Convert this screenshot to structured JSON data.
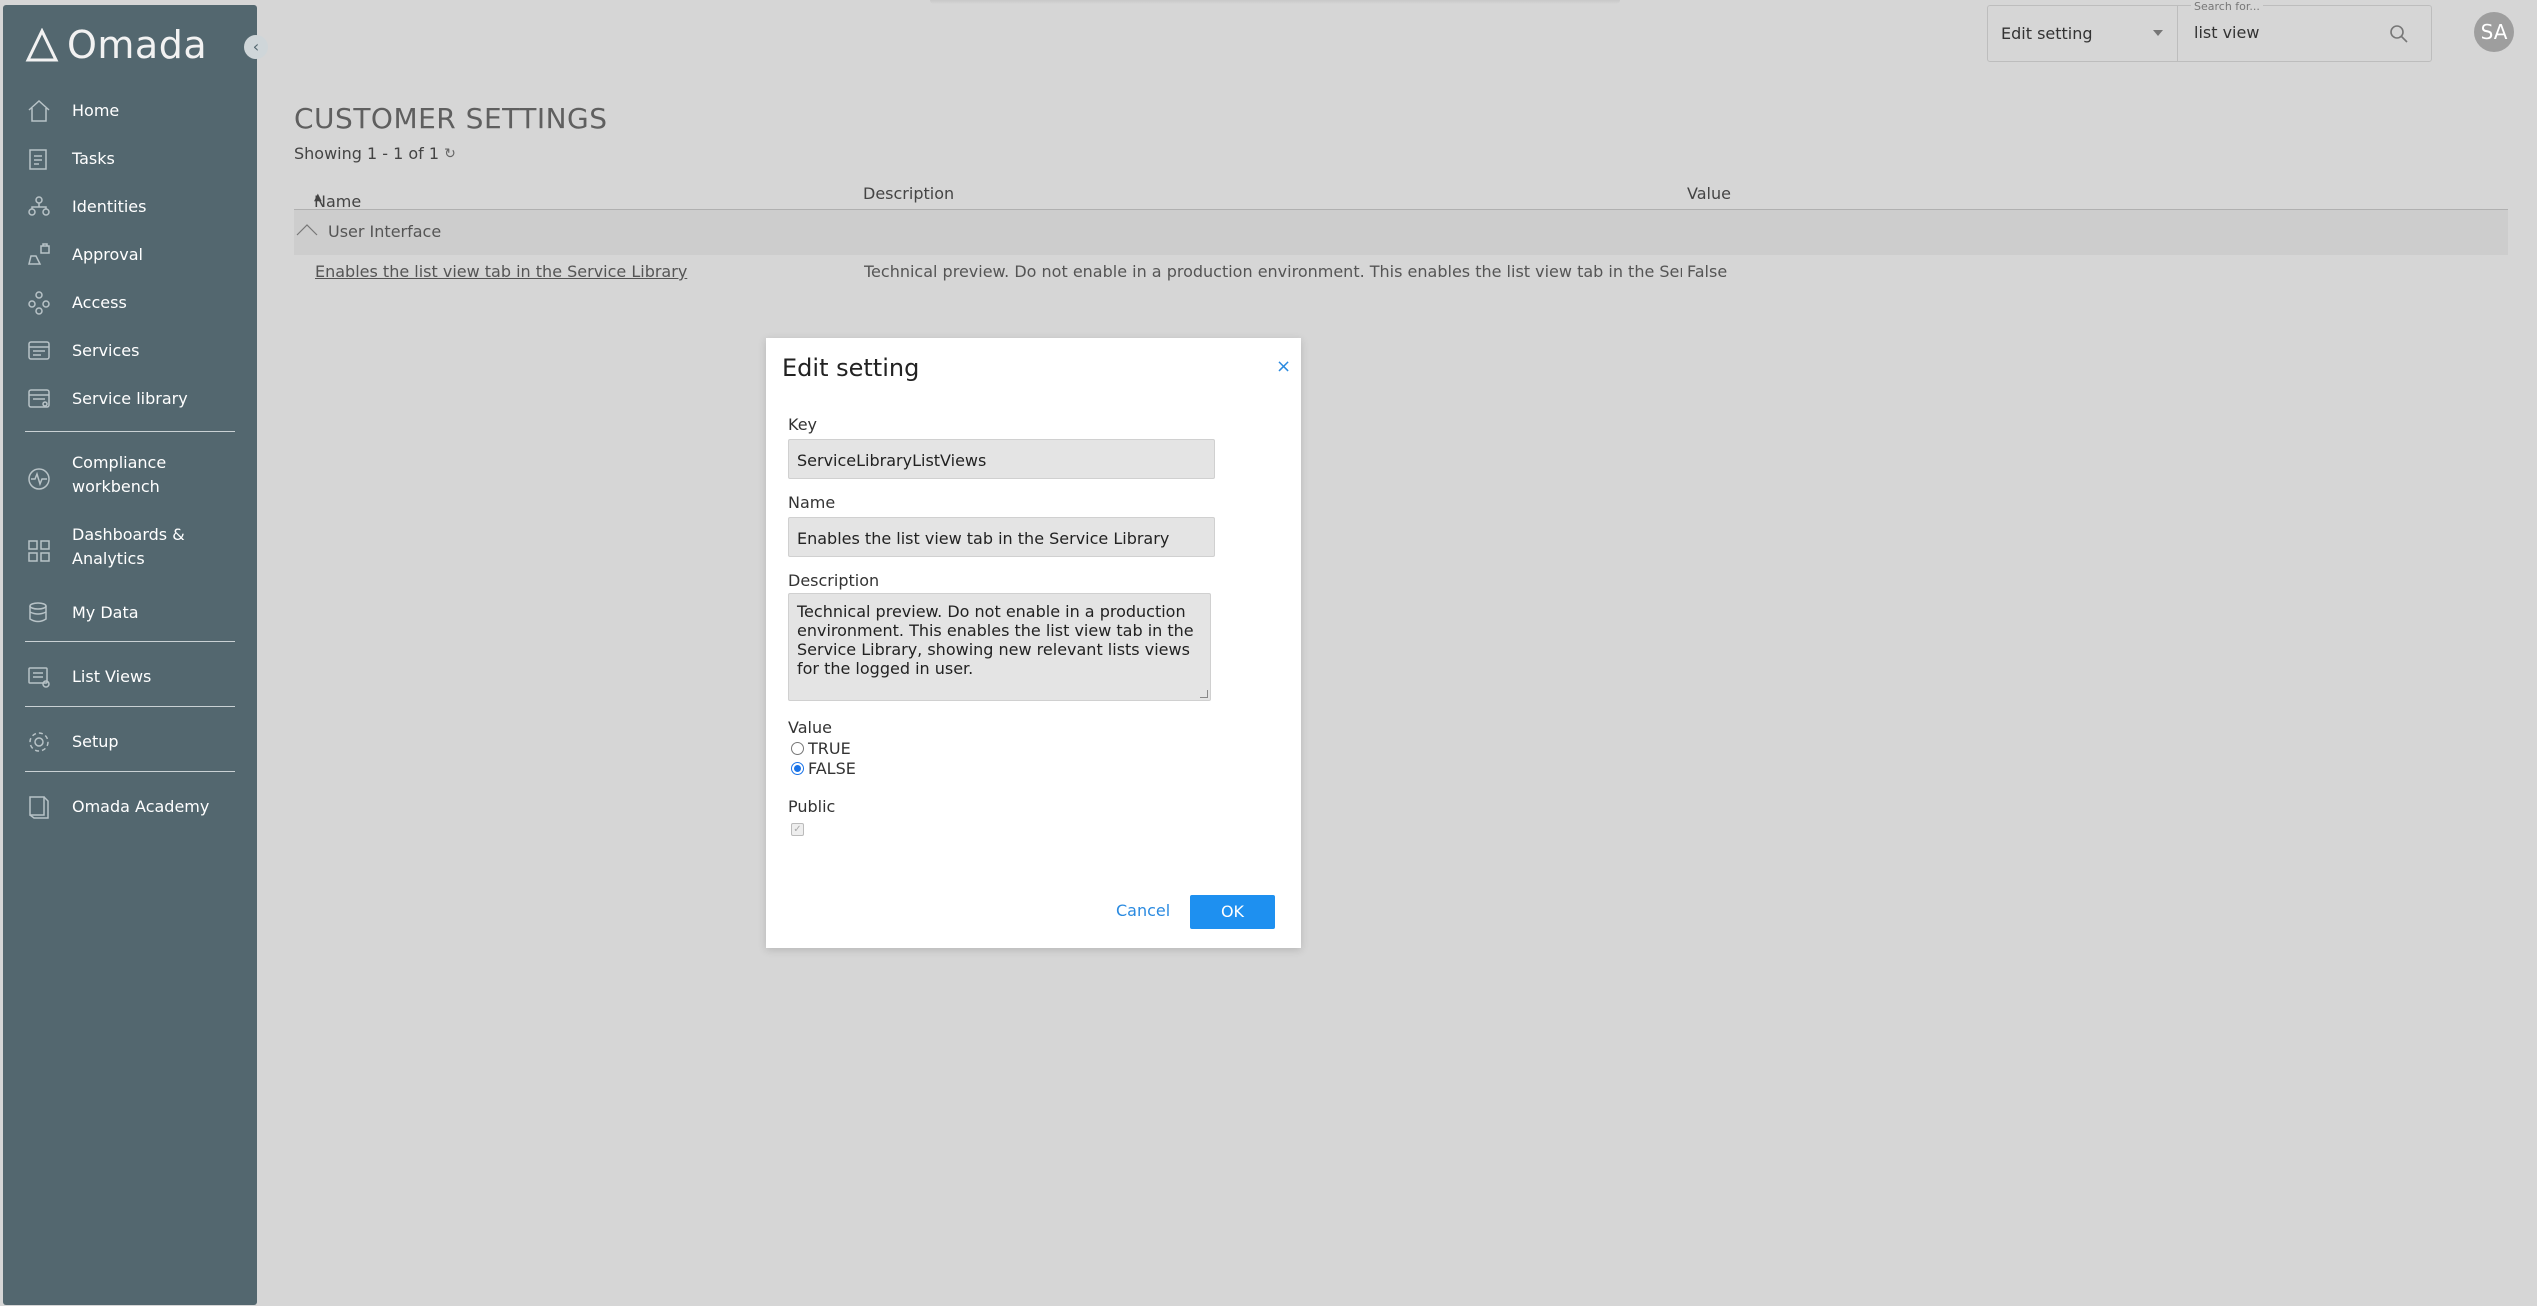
{
  "app": {
    "logo_text": "Omada"
  },
  "sidebar": {
    "items": [
      {
        "label": "Home",
        "icon": "home-icon"
      },
      {
        "label": "Tasks",
        "icon": "tasks-icon"
      },
      {
        "label": "Identities",
        "icon": "identities-icon"
      },
      {
        "label": "Approval",
        "icon": "approval-icon"
      },
      {
        "label": "Access",
        "icon": "access-icon"
      },
      {
        "label": "Services",
        "icon": "services-icon"
      },
      {
        "label": "Service library",
        "icon": "service-library-icon"
      },
      {
        "label": "Compliance workbench",
        "icon": "compliance-icon"
      },
      {
        "label": "Dashboards & Analytics",
        "icon": "dashboards-icon"
      },
      {
        "label": "My Data",
        "icon": "my-data-icon"
      },
      {
        "label": "List Views",
        "icon": "list-views-icon"
      },
      {
        "label": "Setup",
        "icon": "setup-icon"
      },
      {
        "label": "Omada Academy",
        "icon": "academy-icon"
      }
    ]
  },
  "topbar": {
    "scope_value": "Edit setting",
    "search_legend": "Search for...",
    "search_value": "list view",
    "avatar_initials": "SA"
  },
  "main": {
    "title": "CUSTOMER SETTINGS",
    "showing": "Showing 1 - 1 of 1",
    "columns": {
      "name": "Name",
      "description": "Description",
      "value": "Value"
    },
    "group_label": "User Interface",
    "rows": [
      {
        "name": "Enables the list view tab in the Service Library",
        "description": "Technical preview. Do not enable in a production environment. This enables the list view tab in the Service Library…",
        "value": "False"
      }
    ]
  },
  "dialog": {
    "title": "Edit setting",
    "close_symbol": "×",
    "key_label": "Key",
    "key_value": "ServiceLibraryListViews",
    "name_label": "Name",
    "name_value": "Enables the list view tab in the Service Library",
    "description_label": "Description",
    "description_value": "Technical preview. Do not enable in a production environment. This enables the list view tab in the Service Library, showing new relevant lists views for the logged in user.",
    "value_label": "Value",
    "option_true": "TRUE",
    "option_false": "FALSE",
    "selected_option": "FALSE",
    "public_label": "Public",
    "public_checked": true,
    "cancel_label": "Cancel",
    "ok_label": "OK"
  },
  "colors": {
    "sidebar_bg": "#53676f",
    "accent": "#1e90f0",
    "link": "#2a8ae0"
  }
}
